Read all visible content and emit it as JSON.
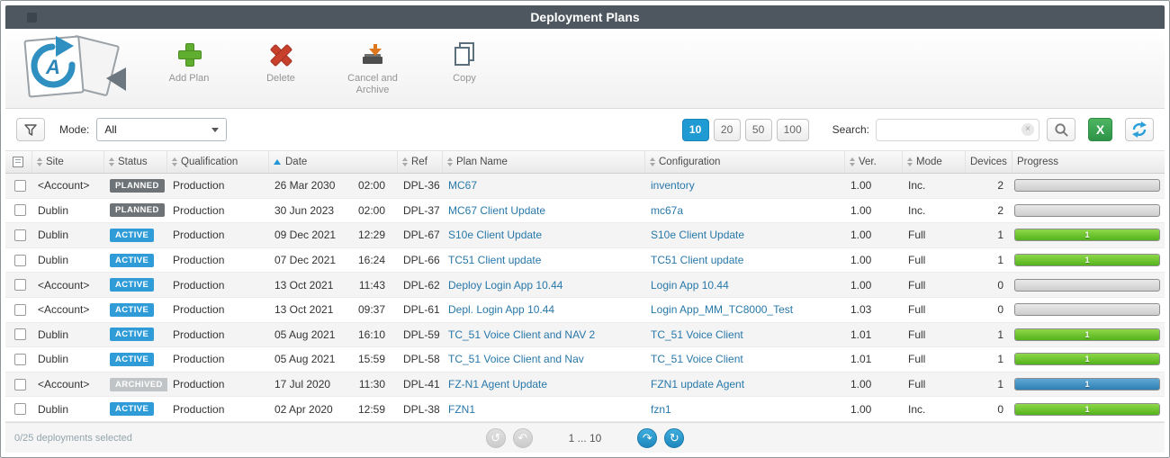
{
  "title": "Deployment Plans",
  "toolbar": {
    "add_plan": "Add Plan",
    "delete": "Delete",
    "cancel_archive": "Cancel and Archive",
    "copy": "Copy"
  },
  "filter_bar": {
    "mode_label": "Mode:",
    "mode_value": "All",
    "page_sizes": [
      "10",
      "20",
      "50",
      "100"
    ],
    "active_page_size": "10",
    "search_label": "Search:",
    "search_value": ""
  },
  "icons": {
    "clear": "×",
    "excel": "X",
    "first": "↺",
    "prev": "↶",
    "next": "↷",
    "last": "↻"
  },
  "colors": {
    "accent_blue": "#1f9ad2",
    "status_planned": "#6d7377",
    "status_active": "#2f9cd8",
    "status_archived": "#c1c4c6",
    "progress_green": "#54b21c",
    "progress_blue": "#2f7fb4",
    "link_blue": "#2878a9"
  },
  "table": {
    "columns": {
      "site": "Site",
      "status": "Status",
      "qualification": "Qualification",
      "date": "Date",
      "ref": "Ref",
      "plan_name": "Plan Name",
      "configuration": "Configuration",
      "ver": "Ver.",
      "mode": "Mode",
      "devices": "Devices",
      "progress": "Progress"
    },
    "sort": {
      "column": "Date",
      "direction": "asc"
    },
    "rows": [
      {
        "site": "<Account>",
        "status": "PLANNED",
        "qualification": "Production",
        "date": "26 Mar 2030",
        "time": "02:00",
        "ref": "DPL-36",
        "plan_name": "MC67",
        "configuration": "inventory",
        "ver": "1.00",
        "mode": "Inc.",
        "devices": "2",
        "progress_color": "gray",
        "progress_label": ""
      },
      {
        "site": "Dublin",
        "status": "PLANNED",
        "qualification": "Production",
        "date": "30 Jun 2023",
        "time": "02:00",
        "ref": "DPL-37",
        "plan_name": "MC67 Client Update",
        "configuration": "mc67a",
        "ver": "1.00",
        "mode": "Inc.",
        "devices": "2",
        "progress_color": "gray",
        "progress_label": ""
      },
      {
        "site": "Dublin",
        "status": "ACTIVE",
        "qualification": "Production",
        "date": "09 Dec 2021",
        "time": "12:29",
        "ref": "DPL-67",
        "plan_name": "S10e Client Update",
        "configuration": "S10e Client Update",
        "ver": "1.00",
        "mode": "Full",
        "devices": "1",
        "progress_color": "green",
        "progress_label": "1"
      },
      {
        "site": "Dublin",
        "status": "ACTIVE",
        "qualification": "Production",
        "date": "07 Dec 2021",
        "time": "16:24",
        "ref": "DPL-66",
        "plan_name": "TC51 Client update",
        "configuration": "TC51 Client update",
        "ver": "1.00",
        "mode": "Full",
        "devices": "1",
        "progress_color": "green",
        "progress_label": "1"
      },
      {
        "site": "<Account>",
        "status": "ACTIVE",
        "qualification": "Production",
        "date": "13 Oct 2021",
        "time": "11:43",
        "ref": "DPL-62",
        "plan_name": "Deploy Login App 10.44",
        "configuration": "Login App 10.44",
        "ver": "1.00",
        "mode": "Full",
        "devices": "0",
        "progress_color": "gray",
        "progress_label": ""
      },
      {
        "site": "<Account>",
        "status": "ACTIVE",
        "qualification": "Production",
        "date": "13 Oct 2021",
        "time": "09:37",
        "ref": "DPL-61",
        "plan_name": "Depl. Login App 10.44",
        "configuration": "Login App_MM_TC8000_Test",
        "ver": "1.03",
        "mode": "Full",
        "devices": "0",
        "progress_color": "gray",
        "progress_label": ""
      },
      {
        "site": "Dublin",
        "status": "ACTIVE",
        "qualification": "Production",
        "date": "05 Aug 2021",
        "time": "16:10",
        "ref": "DPL-59",
        "plan_name": "TC_51 Voice Client and NAV 2",
        "configuration": "TC_51 Voice Client",
        "ver": "1.01",
        "mode": "Full",
        "devices": "1",
        "progress_color": "green",
        "progress_label": "1"
      },
      {
        "site": "Dublin",
        "status": "ACTIVE",
        "qualification": "Production",
        "date": "05 Aug 2021",
        "time": "15:59",
        "ref": "DPL-58",
        "plan_name": "TC_51 Voice Client and Nav",
        "configuration": "TC_51 Voice Client",
        "ver": "1.01",
        "mode": "Full",
        "devices": "1",
        "progress_color": "green",
        "progress_label": "1"
      },
      {
        "site": "<Account>",
        "status": "ARCHIVED",
        "qualification": "Production",
        "date": "17 Jul 2020",
        "time": "11:30",
        "ref": "DPL-41",
        "plan_name": "FZ-N1 Agent Update",
        "configuration": "FZN1 update Agent",
        "ver": "1.00",
        "mode": "Full",
        "devices": "1",
        "progress_color": "blue",
        "progress_label": "1"
      },
      {
        "site": "Dublin",
        "status": "ACTIVE",
        "qualification": "Production",
        "date": "02 Apr 2020",
        "time": "12:59",
        "ref": "DPL-38",
        "plan_name": "FZN1",
        "configuration": "fzn1",
        "ver": "1.00",
        "mode": "Inc.",
        "devices": "0",
        "progress_color": "green",
        "progress_label": "1"
      }
    ]
  },
  "footer": {
    "selection_text": "0/25 deployments selected",
    "page_label": "1 ... 10"
  }
}
